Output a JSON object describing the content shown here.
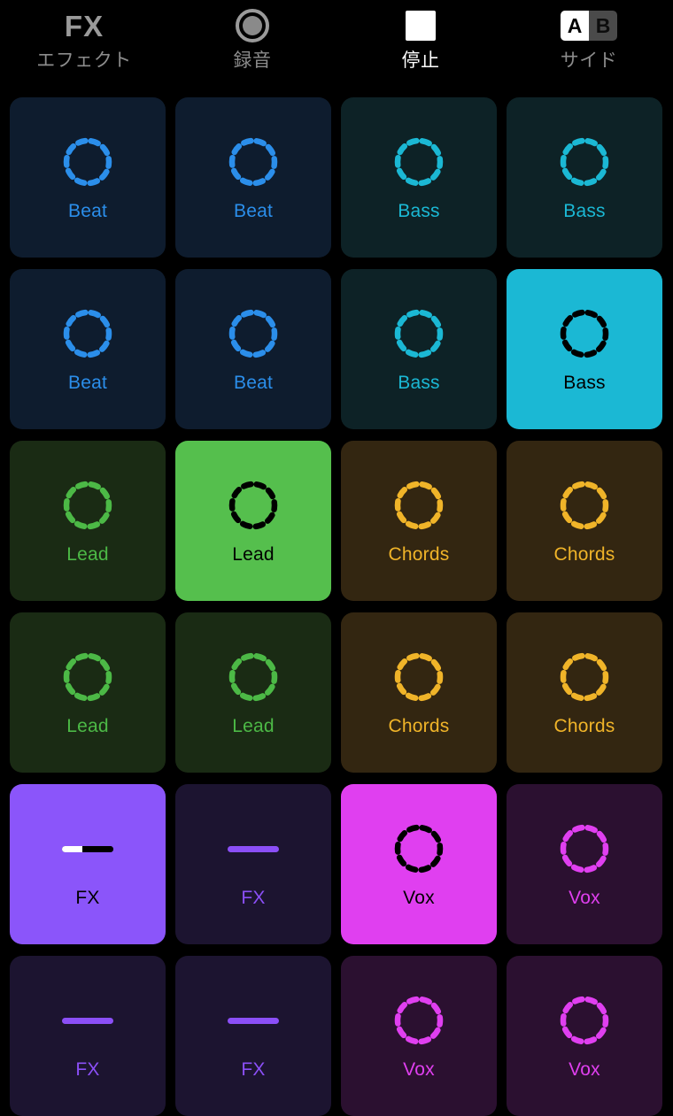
{
  "toolbar": {
    "items": [
      {
        "icon": "fx-text-icon",
        "glyph": "FX",
        "label": "エフェクト",
        "active": false
      },
      {
        "icon": "record-icon",
        "glyph": "record",
        "label": "録音",
        "active": false
      },
      {
        "icon": "stop-icon",
        "glyph": "stop",
        "label": "停止",
        "active": true
      },
      {
        "icon": "ab-toggle-icon",
        "glyph": "AB",
        "label": "サイド",
        "active": false
      }
    ],
    "ab_toggle": {
      "a_label": "A",
      "b_label": "B",
      "selected": "A"
    }
  },
  "colors": {
    "beat_bg": "#0e1c2e",
    "beat_fg": "#2b8eea",
    "beat_active_bg": "#2b8eea",
    "bass_bg": "#0d2226",
    "bass_fg": "#1bb8d4",
    "bass_active_bg": "#1bb8d4",
    "lead_bg": "#1a2b14",
    "lead_fg": "#4cb946",
    "lead_active_bg": "#55bf4d",
    "chords_bg": "#332611",
    "chords_fg": "#f0b429",
    "chords_active_bg": "#f0b429",
    "fx_bg": "#1c1430",
    "fx_fg": "#8b4ff7",
    "fx_active_bg": "#8b55fa",
    "vox_bg": "#2b1030",
    "vox_fg": "#e03ff0",
    "vox_active_bg": "#e03ff0",
    "active_ink": "#000000",
    "background": "#000000"
  },
  "grid": {
    "columns": 4,
    "rows": 6,
    "pads": [
      {
        "label": "Beat",
        "type": "beat",
        "icon": "dashed-circle-icon",
        "active": false
      },
      {
        "label": "Beat",
        "type": "beat",
        "icon": "dashed-circle-icon",
        "active": false
      },
      {
        "label": "Bass",
        "type": "bass",
        "icon": "dashed-circle-icon",
        "active": false
      },
      {
        "label": "Bass",
        "type": "bass",
        "icon": "dashed-circle-icon",
        "active": false
      },
      {
        "label": "Beat",
        "type": "beat",
        "icon": "dashed-circle-icon",
        "active": false
      },
      {
        "label": "Beat",
        "type": "beat",
        "icon": "dashed-circle-icon",
        "active": false
      },
      {
        "label": "Bass",
        "type": "bass",
        "icon": "dashed-circle-icon",
        "active": false
      },
      {
        "label": "Bass",
        "type": "bass",
        "icon": "dashed-circle-icon",
        "active": true
      },
      {
        "label": "Lead",
        "type": "lead",
        "icon": "dashed-circle-icon",
        "active": false
      },
      {
        "label": "Lead",
        "type": "lead",
        "icon": "dashed-circle-icon",
        "active": true
      },
      {
        "label": "Chords",
        "type": "chords",
        "icon": "dashed-circle-icon",
        "active": false
      },
      {
        "label": "Chords",
        "type": "chords",
        "icon": "dashed-circle-icon",
        "active": false
      },
      {
        "label": "Lead",
        "type": "lead",
        "icon": "dashed-circle-icon",
        "active": false
      },
      {
        "label": "Lead",
        "type": "lead",
        "icon": "dashed-circle-icon",
        "active": false
      },
      {
        "label": "Chords",
        "type": "chords",
        "icon": "dashed-circle-icon",
        "active": false
      },
      {
        "label": "Chords",
        "type": "chords",
        "icon": "dashed-circle-icon",
        "active": false
      },
      {
        "label": "FX",
        "type": "fx",
        "icon": "slider-icon",
        "active": true,
        "slider_value": 40
      },
      {
        "label": "FX",
        "type": "fx",
        "icon": "slider-icon",
        "active": false,
        "slider_value": 0
      },
      {
        "label": "Vox",
        "type": "vox",
        "icon": "dashed-circle-icon",
        "active": true
      },
      {
        "label": "Vox",
        "type": "vox",
        "icon": "dashed-circle-icon",
        "active": false
      },
      {
        "label": "FX",
        "type": "fx",
        "icon": "slider-icon",
        "active": false,
        "slider_value": 0
      },
      {
        "label": "FX",
        "type": "fx",
        "icon": "slider-icon",
        "active": false,
        "slider_value": 0
      },
      {
        "label": "Vox",
        "type": "vox",
        "icon": "dashed-circle-icon",
        "active": false
      },
      {
        "label": "Vox",
        "type": "vox",
        "icon": "dashed-circle-icon",
        "active": false
      }
    ]
  }
}
